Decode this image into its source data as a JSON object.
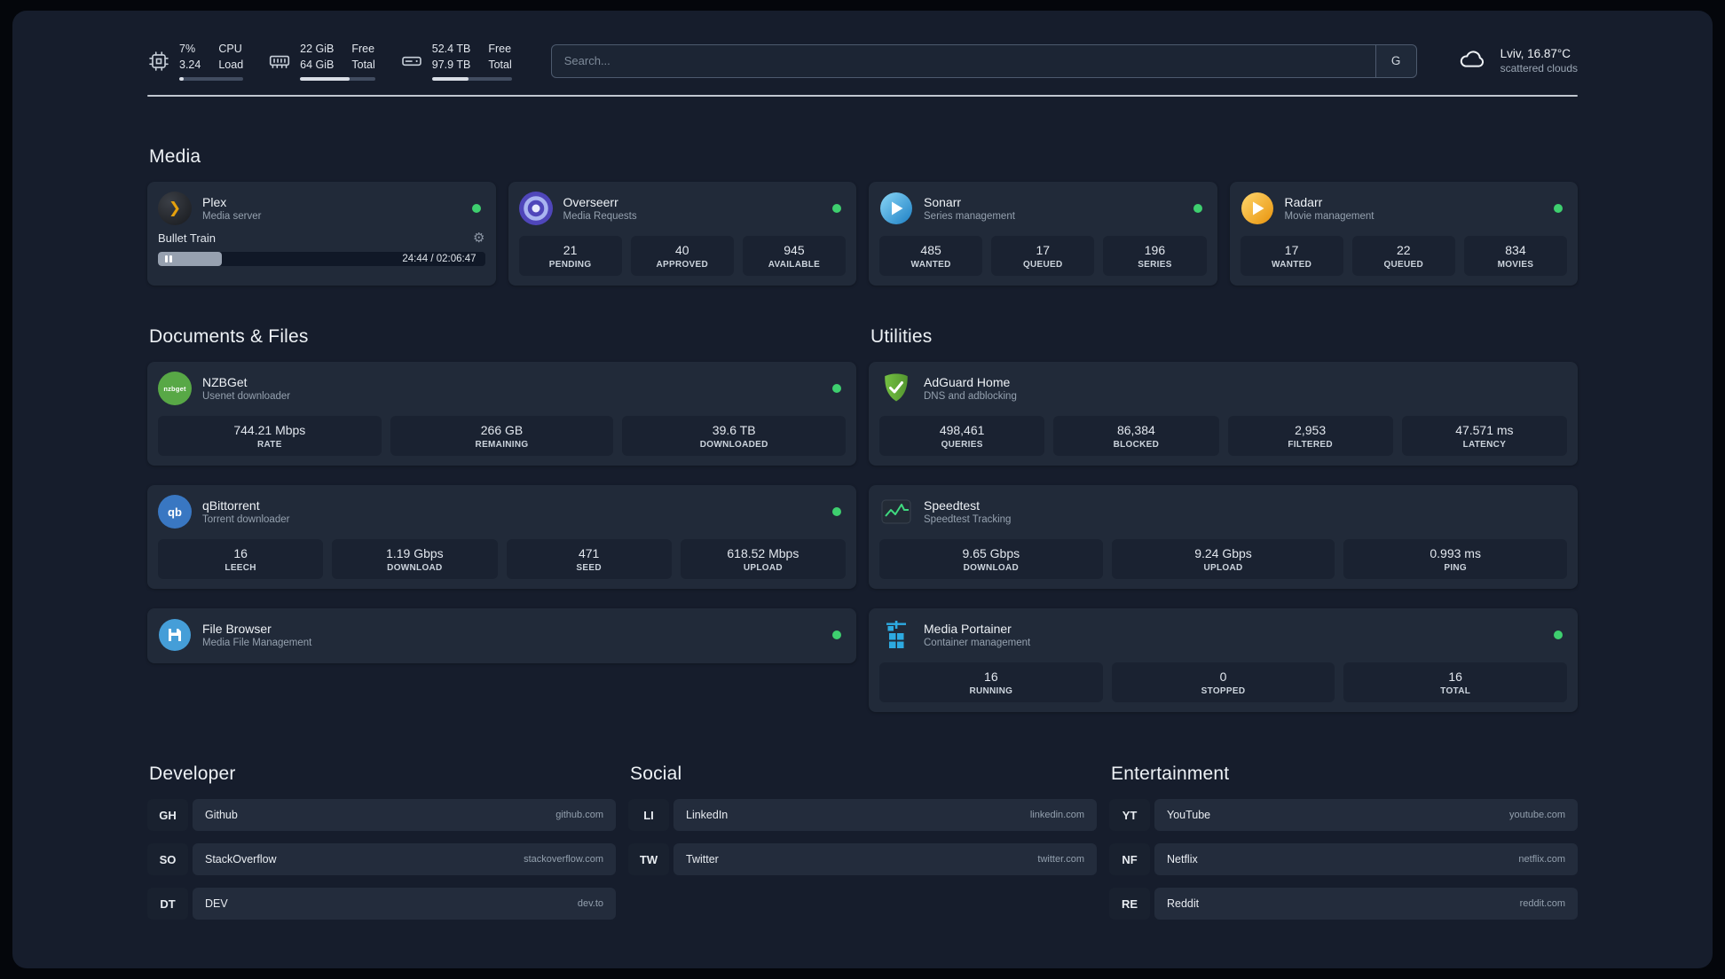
{
  "colors": {
    "status_online": "#3ecf6f",
    "page_background": "#161d2c",
    "card_background": "#212a39",
    "speedtest_line": "#3fd97f"
  },
  "topbar": {
    "cpu": {
      "percent": "7%",
      "load": "3.24",
      "label_top": "CPU",
      "label_bottom": "Load",
      "bar_percent": 7
    },
    "memory": {
      "free": "22 GiB",
      "total": "64 GiB",
      "label_top": "Free",
      "label_bottom": "Total",
      "bar_percent": 66
    },
    "disk": {
      "free": "52.4 TB",
      "total": "97.9 TB",
      "label_top": "Free",
      "label_bottom": "Total",
      "bar_percent": 46
    },
    "search": {
      "placeholder": "Search...",
      "provider": "G"
    },
    "weather": {
      "location": "Lviv, 16.87°C",
      "condition": "scattered clouds"
    }
  },
  "media": {
    "title": "Media",
    "plex": {
      "name": "Plex",
      "subtitle": "Media server",
      "now_playing": "Bullet Train",
      "time": "24:44 / 02:06:47",
      "progress_percent": 19.5
    },
    "overseerr": {
      "name": "Overseerr",
      "subtitle": "Media Requests",
      "stats": [
        {
          "value": "21",
          "label": "PENDING"
        },
        {
          "value": "40",
          "label": "APPROVED"
        },
        {
          "value": "945",
          "label": "AVAILABLE"
        }
      ]
    },
    "sonarr": {
      "name": "Sonarr",
      "subtitle": "Series management",
      "stats": [
        {
          "value": "485",
          "label": "WANTED"
        },
        {
          "value": "17",
          "label": "QUEUED"
        },
        {
          "value": "196",
          "label": "SERIES"
        }
      ]
    },
    "radarr": {
      "name": "Radarr",
      "subtitle": "Movie management",
      "stats": [
        {
          "value": "17",
          "label": "WANTED"
        },
        {
          "value": "22",
          "label": "QUEUED"
        },
        {
          "value": "834",
          "label": "MOVIES"
        }
      ]
    }
  },
  "documents": {
    "title": "Documents & Files",
    "nzbget": {
      "name": "NZBGet",
      "subtitle": "Usenet downloader",
      "logo_text": "nzbget",
      "stats": [
        {
          "value": "744.21 Mbps",
          "label": "RATE"
        },
        {
          "value": "266 GB",
          "label": "REMAINING"
        },
        {
          "value": "39.6 TB",
          "label": "DOWNLOADED"
        }
      ]
    },
    "qbittorrent": {
      "name": "qBittorrent",
      "subtitle": "Torrent downloader",
      "logo_text": "qb",
      "stats": [
        {
          "value": "16",
          "label": "LEECH"
        },
        {
          "value": "1.19 Gbps",
          "label": "DOWNLOAD"
        },
        {
          "value": "471",
          "label": "SEED"
        },
        {
          "value": "618.52 Mbps",
          "label": "UPLOAD"
        }
      ]
    },
    "filebrowser": {
      "name": "File Browser",
      "subtitle": "Media File Management"
    }
  },
  "utilities": {
    "title": "Utilities",
    "adguard": {
      "name": "AdGuard Home",
      "subtitle": "DNS and adblocking",
      "stats": [
        {
          "value": "498,461",
          "label": "QUERIES"
        },
        {
          "value": "86,384",
          "label": "BLOCKED"
        },
        {
          "value": "2,953",
          "label": "FILTERED"
        },
        {
          "value": "47.571 ms",
          "label": "LATENCY"
        }
      ]
    },
    "speedtest": {
      "name": "Speedtest",
      "subtitle": "Speedtest Tracking",
      "stats": [
        {
          "value": "9.65 Gbps",
          "label": "DOWNLOAD"
        },
        {
          "value": "9.24 Gbps",
          "label": "UPLOAD"
        },
        {
          "value": "0.993 ms",
          "label": "PING"
        }
      ]
    },
    "portainer": {
      "name": "Media Portainer",
      "subtitle": "Container management",
      "stats": [
        {
          "value": "16",
          "label": "RUNNING"
        },
        {
          "value": "0",
          "label": "STOPPED"
        },
        {
          "value": "16",
          "label": "TOTAL"
        }
      ]
    }
  },
  "bookmarks": {
    "developer": {
      "title": "Developer",
      "items": [
        {
          "abbr": "GH",
          "name": "Github",
          "url": "github.com"
        },
        {
          "abbr": "SO",
          "name": "StackOverflow",
          "url": "stackoverflow.com"
        },
        {
          "abbr": "DT",
          "name": "DEV",
          "url": "dev.to"
        }
      ]
    },
    "social": {
      "title": "Social",
      "items": [
        {
          "abbr": "LI",
          "name": "LinkedIn",
          "url": "linkedin.com"
        },
        {
          "abbr": "TW",
          "name": "Twitter",
          "url": "twitter.com"
        }
      ]
    },
    "entertainment": {
      "title": "Entertainment",
      "items": [
        {
          "abbr": "YT",
          "name": "YouTube",
          "url": "youtube.com"
        },
        {
          "abbr": "NF",
          "name": "Netflix",
          "url": "netflix.com"
        },
        {
          "abbr": "RE",
          "name": "Reddit",
          "url": "reddit.com"
        }
      ]
    }
  }
}
